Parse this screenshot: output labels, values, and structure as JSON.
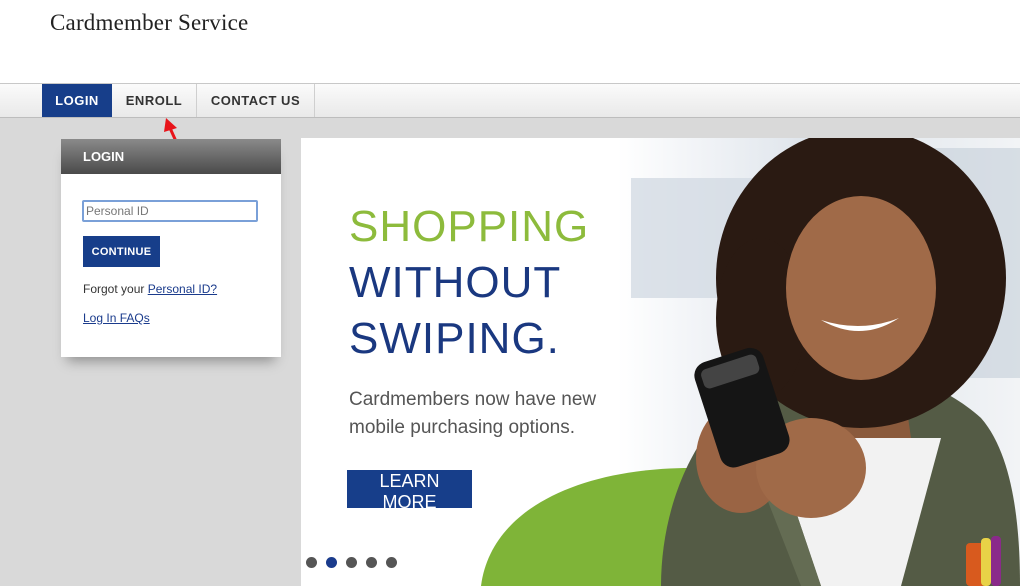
{
  "header": {
    "brand": "Cardmember Service"
  },
  "nav": {
    "tabs": [
      {
        "label": "LOGIN",
        "active": true
      },
      {
        "label": "ENROLL",
        "active": false
      },
      {
        "label": "CONTACT US",
        "active": false
      }
    ]
  },
  "login": {
    "title": "LOGIN",
    "personal_id_placeholder": "Personal ID",
    "personal_id_value": "",
    "continue_label": "CONTINUE",
    "forgot_prefix": "Forgot your ",
    "forgot_link": "Personal ID?",
    "faqs_link": "Log In FAQs"
  },
  "banner": {
    "headline_1": "SHOPPING",
    "headline_2": "WITHOUT",
    "headline_3": "SWIPING.",
    "sub_1": "Cardmembers now have new",
    "sub_2": "mobile purchasing options.",
    "cta_label": "LEARN MORE",
    "slide_count": 5,
    "active_slide": 2
  },
  "colors": {
    "primary": "#173e8a",
    "accent_green": "#8dbb3c",
    "annotation_arrow": "#e8141a"
  }
}
